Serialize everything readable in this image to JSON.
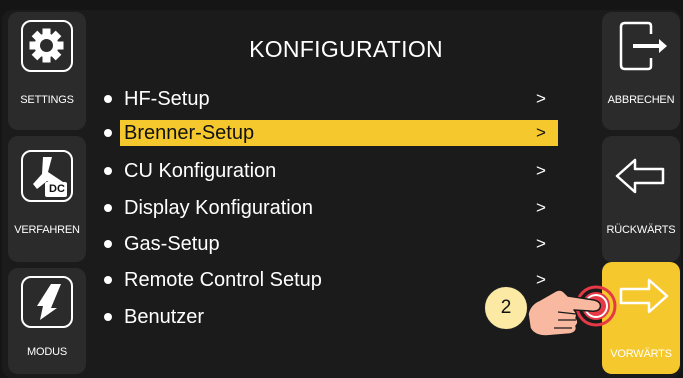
{
  "left_panel": {
    "items": [
      {
        "label": "SETTINGS",
        "icon": "gear-icon"
      },
      {
        "label": "VERFAHREN",
        "icon": "torch-dc-icon",
        "icon_text": "DC"
      },
      {
        "label": "MODUS",
        "icon": "trigger-icon"
      }
    ]
  },
  "right_panel": {
    "items": [
      {
        "label": "ABBRECHEN",
        "icon": "exit-icon"
      },
      {
        "label": "RÜCKWÄRTS",
        "icon": "arrow-left-icon"
      },
      {
        "label": "VORWÄRTS",
        "icon": "arrow-right-icon",
        "active": true
      }
    ]
  },
  "screen": {
    "title": "KONFIGURATION",
    "menu": [
      {
        "label": "HF-Setup",
        "arrow": ">"
      },
      {
        "label": "Brenner-Setup",
        "arrow": ">",
        "selected": true
      },
      {
        "label": "CU Konfiguration",
        "arrow": ">"
      },
      {
        "label": "Display Konfiguration",
        "arrow": ">"
      },
      {
        "label": "Gas-Setup",
        "arrow": ">"
      },
      {
        "label": "Remote Control Setup",
        "arrow": ">"
      },
      {
        "label": "Benutzer",
        "arrow": ""
      }
    ]
  },
  "callout": {
    "number": "2",
    "icon": "press-hand-icon"
  },
  "colors": {
    "background": "#151515",
    "panel": "#2b2b2b",
    "highlight": "#f5c92e",
    "callout": "#fbe9a4",
    "press_red": "#e53946"
  }
}
